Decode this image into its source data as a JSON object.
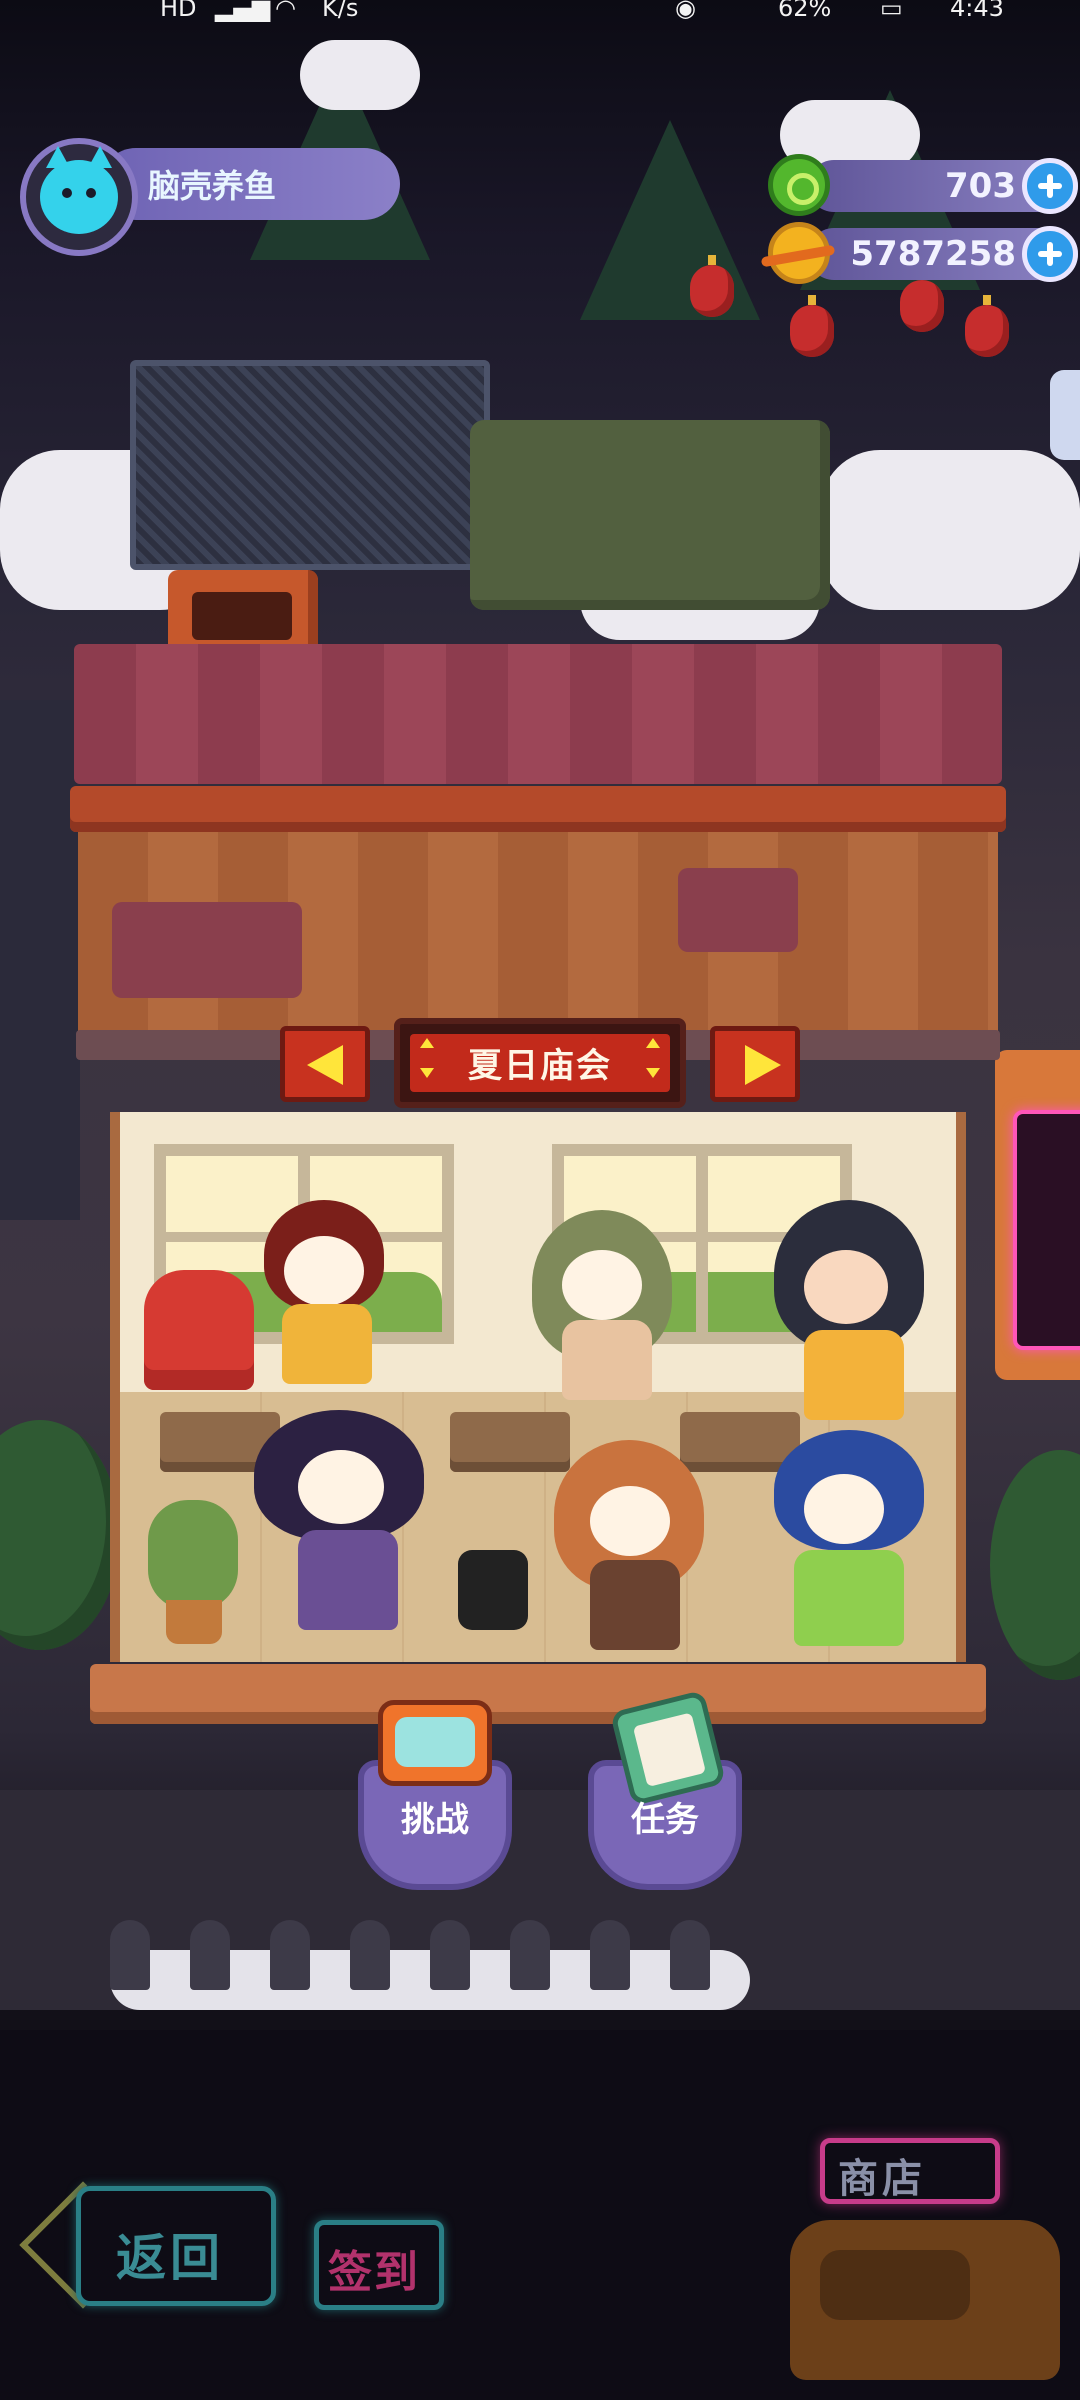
{
  "status_bar": {
    "network_label": "HD",
    "speed_unit": "K/s",
    "battery": "62%",
    "time": "4:43"
  },
  "player": {
    "name": "脑壳养鱼",
    "avatar_icon": "cyan-cat-icon"
  },
  "currencies": [
    {
      "icon": "green-donut-coin-icon",
      "value": "703",
      "color": "#53b72d"
    },
    {
      "icon": "gold-planet-coin-icon",
      "value": "5787258",
      "color": "#f3b21f"
    }
  ],
  "room": {
    "title": "夏日庙会",
    "prev_icon": "arrow-left-icon",
    "next_icon": "arrow-right-icon"
  },
  "actions": [
    {
      "label": "挑战",
      "icon": "tv-icon"
    },
    {
      "label": "任务",
      "icon": "clipboard-icon"
    }
  ],
  "nav": {
    "back_label": "返回",
    "signin_label": "签到",
    "shop_label": "商店"
  },
  "colors": {
    "accent_purple": "#7a67b7",
    "sign_red": "#c22a1b",
    "arrow_yellow": "#ffe53a",
    "neon_teal": "#2a7f86",
    "neon_pink": "#c73c8a"
  }
}
